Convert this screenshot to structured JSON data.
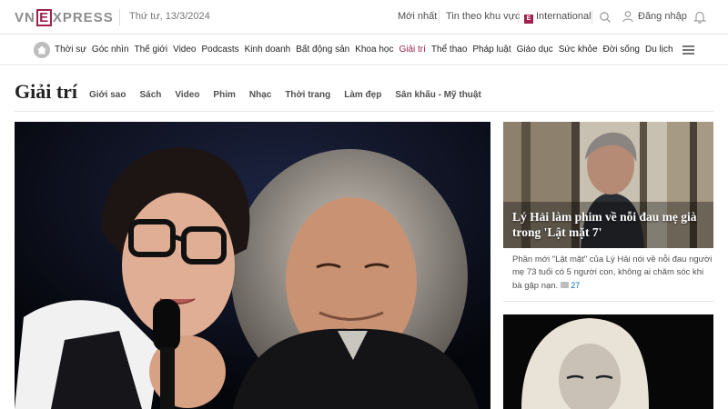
{
  "topbar": {
    "logo_left": "VN",
    "logo_box": "E",
    "logo_right": "XPRESS",
    "date": "Thứ tư, 13/3/2024",
    "latest": "Mới nhất",
    "regional": "Tin theo khu vực",
    "intl_icon": "E",
    "international": "International",
    "login": "Đăng nhập",
    "icons": [
      "search-icon",
      "user-icon",
      "bell-icon"
    ]
  },
  "nav": {
    "home_icon": "home-icon",
    "items": [
      "Thời sự",
      "Góc nhìn",
      "Thế giới",
      "Video",
      "Podcasts",
      "Kinh doanh",
      "Bất động sản",
      "Khoa học",
      "Giải trí",
      "Thể thao",
      "Pháp luật",
      "Giáo dục",
      "Sức khỏe",
      "Đời sống",
      "Du lịch"
    ],
    "active": "Giải trí",
    "menu_icon": "hamburger-icon"
  },
  "section": {
    "title": "Giải trí",
    "subnav": [
      "Giới sao",
      "Sách",
      "Video",
      "Phim",
      "Nhạc",
      "Thời trang",
      "Làm đẹp",
      "Sân khấu - Mỹ thuật"
    ]
  },
  "side": {
    "title": "Lý Hải làm phim về nỗi đau mẹ già trong 'Lật mặt 7'",
    "desc": "Phần mới \"Lật mặt\" của Lý Hải nói về nỗi đau người mẹ 73 tuổi có 5 người con, không ai chăm sóc khi bà gặp nạn.",
    "comments": "27"
  },
  "colors": {
    "brand": "#9f224e",
    "link": "#076db6"
  }
}
